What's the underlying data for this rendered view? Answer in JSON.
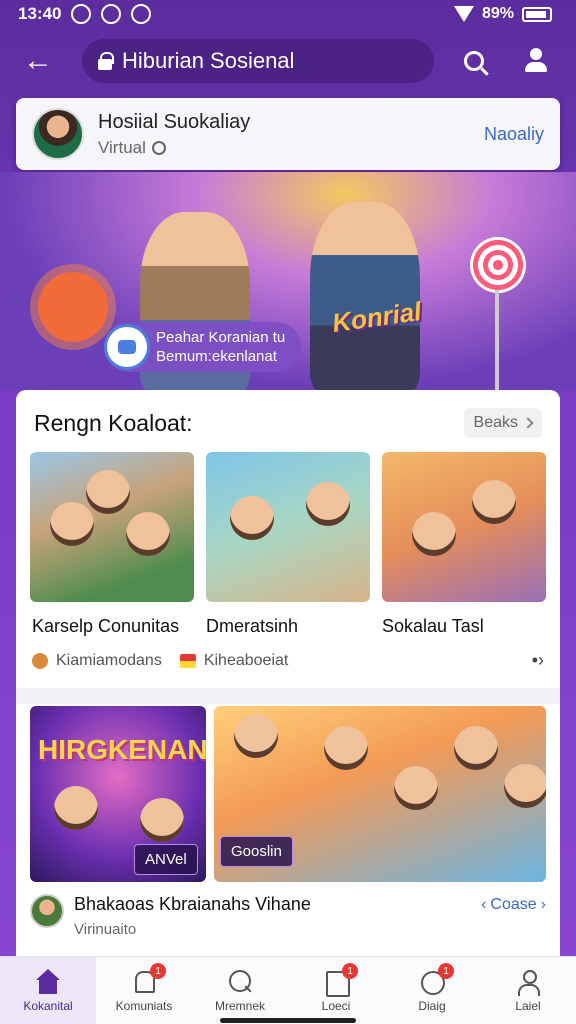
{
  "status_bar": {
    "time": "13:40",
    "battery": "89%"
  },
  "app_bar": {
    "title": "Hiburian Sosienal"
  },
  "profile": {
    "name": "Hosiial Suokaliay",
    "subtitle": "Virtual",
    "action": "Naoaliy"
  },
  "hero": {
    "title": "Konrial",
    "badge_line1": "Peahar Koranian tu",
    "badge_line2": "Bemum:ekenlanat"
  },
  "section": {
    "title": "Rengn Koaloat:",
    "see_all": "Beaks",
    "items": [
      {
        "label": "Karselp Conunitas"
      },
      {
        "label": "Dmeratsinh"
      },
      {
        "label": "Sokalau Tasl"
      }
    ],
    "tags": [
      "Kiamiamodans",
      "Kiheaboeiat"
    ]
  },
  "featured": {
    "big_text": "HIRGKENAN",
    "chip_1": "ANVel",
    "chip_2": "Gooslin"
  },
  "post": {
    "title": "Bhakaoas Kbraianahs Vihane",
    "subtitle": "Virinuaito",
    "action": "Coase"
  },
  "bottom_nav": [
    {
      "label": "Kokanital",
      "icon": "home-icon",
      "badge": ""
    },
    {
      "label": "Komuniats",
      "icon": "bell-icon",
      "badge": "1"
    },
    {
      "label": "Mremnek",
      "icon": "search-icon",
      "badge": ""
    },
    {
      "label": "Loeci",
      "icon": "doc-icon",
      "badge": "1"
    },
    {
      "label": "Diaig",
      "icon": "clock-icon",
      "badge": "1"
    },
    {
      "label": "Laiel",
      "icon": "profile-icon",
      "badge": ""
    }
  ],
  "colors": {
    "primary": "#6a3cb8",
    "accent": "#3b67c9",
    "badge": "#e53935"
  }
}
